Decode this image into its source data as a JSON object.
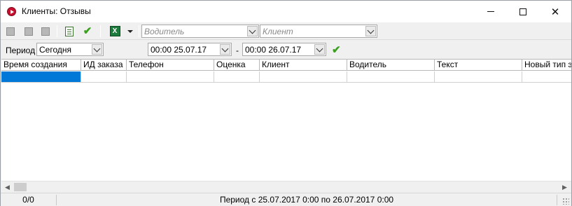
{
  "window": {
    "title": "Клиенты: Отзывы",
    "controls": {
      "minimize": "minimize",
      "maximize": "maximize",
      "close": "✕"
    }
  },
  "toolbar": {
    "icons": [
      "add-icon",
      "edit-icon",
      "delete-icon",
      "clipboard-icon",
      "check-icon",
      "excel-icon",
      "dropdown-icon"
    ],
    "driver_placeholder": "Водитель",
    "client_placeholder": "Клиент"
  },
  "filter": {
    "period_label": "Период",
    "period_value": "Сегодня",
    "from_value": "00:00 25.07.17",
    "separator": "-",
    "to_value": "00:00 26.07.17"
  },
  "table": {
    "columns": [
      "Время создания",
      "ИД заказа",
      "Телефон",
      "Оценка",
      "Клиент",
      "Водитель",
      "Текст",
      "Новый тип эк"
    ],
    "rows": []
  },
  "statusbar": {
    "counter": "0/0",
    "period_text": "Период с 25.07.2017 0:00 по 26.07.2017 0:00"
  },
  "colors": {
    "selection": "#0078d7",
    "accept": "#3aa01e",
    "app_icon": "#c8102e"
  }
}
